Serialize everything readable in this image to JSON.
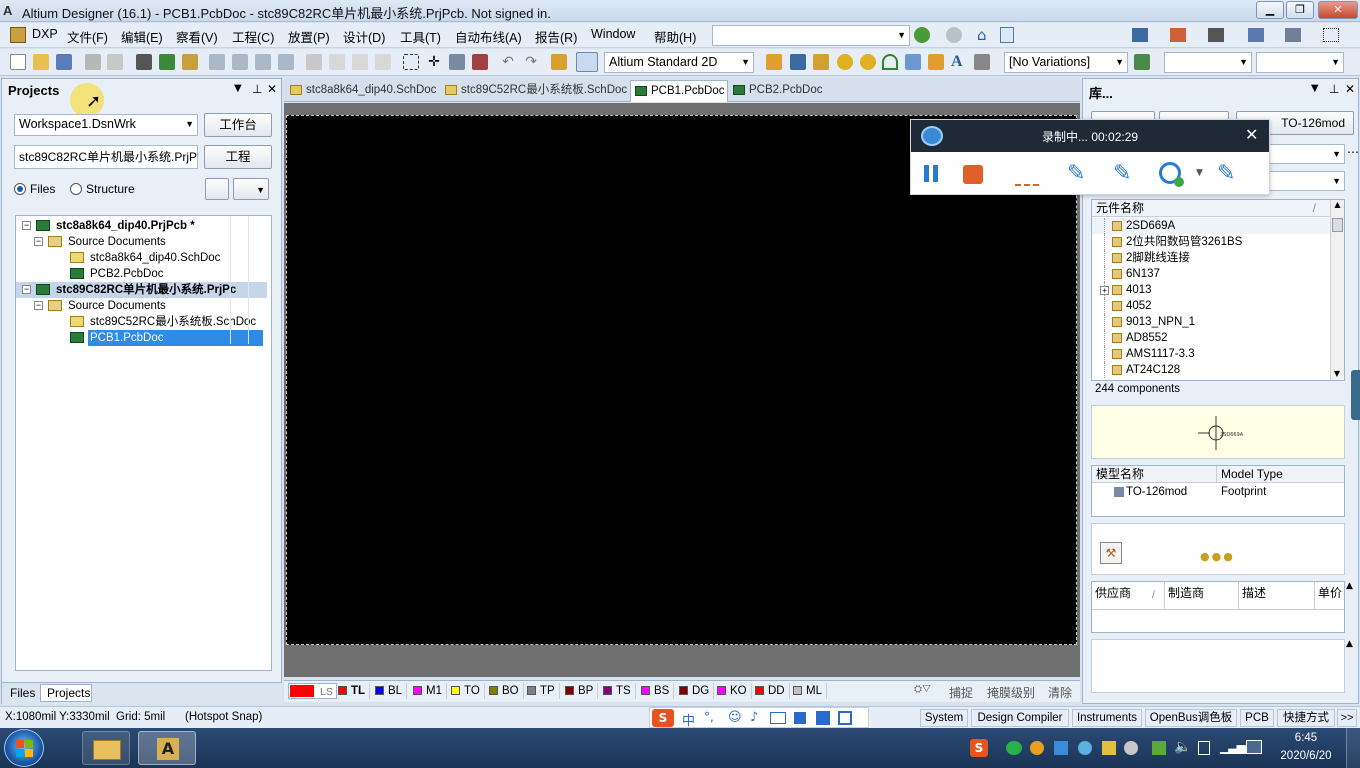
{
  "window": {
    "title": "Altium Designer (16.1) - PCB1.PcbDoc - stc89C82RC单片机最小系统.PrjPcb. Not signed in."
  },
  "menu": [
    "DXP",
    "文件(F)",
    "编辑(E)",
    "察看(V)",
    "工程(C)",
    "放置(P)",
    "设计(D)",
    "工具(T)",
    "自动布线(A)",
    "报告(R)",
    "Window",
    "帮助(H)"
  ],
  "toolbar": {
    "view_mode": "Altium Standard 2D",
    "variations": "[No Variations]"
  },
  "projects_panel": {
    "title": "Projects",
    "workspace": "Workspace1.DsnWrk",
    "workspace_btn": "工作台",
    "project": "stc89C82RC单片机最小系统.PrjPcb",
    "project_btn": "工程",
    "radio_files": "Files",
    "radio_structure": "Structure",
    "tree": [
      {
        "label": "stc8a8k64_dip40.PrjPcb *",
        "level": 0,
        "bold": true,
        "selected": false
      },
      {
        "label": "Source Documents",
        "level": 1,
        "bold": false,
        "selected": false
      },
      {
        "label": "stc8a8k64_dip40.SchDoc",
        "level": 2,
        "bold": false,
        "selected": false
      },
      {
        "label": "PCB2.PcbDoc",
        "level": 2,
        "bold": false,
        "selected": false
      },
      {
        "label": "stc89C82RC单片机最小系统.PrjPc",
        "level": 0,
        "bold": true,
        "selected": "project"
      },
      {
        "label": "Source Documents",
        "level": 1,
        "bold": false,
        "selected": false
      },
      {
        "label": "stc89C52RC最小系统板.SchDoc",
        "level": 2,
        "bold": false,
        "selected": false
      },
      {
        "label": "PCB1.PcbDoc",
        "level": 2,
        "bold": false,
        "selected": "active"
      }
    ],
    "bottom_tabs": [
      "Files",
      "Projects"
    ]
  },
  "doc_tabs": [
    {
      "label": "stc8a8k64_dip40.SchDoc",
      "active": false
    },
    {
      "label": "stc89C52RC最小系统板.SchDoc",
      "active": false
    },
    {
      "label": "PCB1.PcbDoc",
      "active": true
    },
    {
      "label": "PCB2.PcbDoc",
      "active": false
    }
  ],
  "recorder": {
    "status": "录制中... 00:02:29"
  },
  "layers": [
    {
      "label": "LS",
      "color": "#ff0000"
    },
    {
      "label": "TL",
      "color": "#ff0000"
    },
    {
      "label": "BL",
      "color": "#0000ff"
    },
    {
      "label": "M1",
      "color": "#ff00ff"
    },
    {
      "label": "TO",
      "color": "#ffff00"
    },
    {
      "label": "BO",
      "color": "#808000"
    },
    {
      "label": "TP",
      "color": "#808080"
    },
    {
      "label": "BP",
      "color": "#800000"
    },
    {
      "label": "TS",
      "color": "#800080"
    },
    {
      "label": "BS",
      "color": "#ff00ff"
    },
    {
      "label": "DG",
      "color": "#800000"
    },
    {
      "label": "KO",
      "color": "#ff00ff"
    },
    {
      "label": "DD",
      "color": "#ff0000"
    },
    {
      "label": "ML",
      "color": "#c0c0c0"
    }
  ],
  "layer_actions": [
    "捕捉",
    "掩膜级别",
    "清除"
  ],
  "library": {
    "title": "库...",
    "footprint_label": "TO-126mod",
    "col_name": "元件名称",
    "items": [
      "2SD669A",
      "2位共阳数码管3261BS",
      "2脚跳线连接",
      "6N137",
      "4013",
      "4052",
      "9013_NPN_1",
      "AD8552",
      "AMS1117-3.3",
      "AT24C128"
    ],
    "count": "244 components",
    "model_col_name": "模型名称",
    "model_col_type": "Model Type",
    "model_name": "TO-126mod",
    "model_type": "Footprint",
    "supplier_cols": [
      "供应商",
      "制造商",
      "描述",
      "单价"
    ]
  },
  "status": {
    "coords": "X:1080mil Y:3330mil",
    "grid": "Grid: 5mil",
    "snap": "(Hotspot Snap)",
    "right": [
      "System",
      "Design Compiler",
      "Instruments",
      "OpenBus调色板",
      "PCB",
      "快捷方式",
      ">>"
    ]
  },
  "ime": [
    "中",
    "°,"
  ],
  "taskbar": {
    "time": "6:45",
    "date": "2020/6/20"
  }
}
